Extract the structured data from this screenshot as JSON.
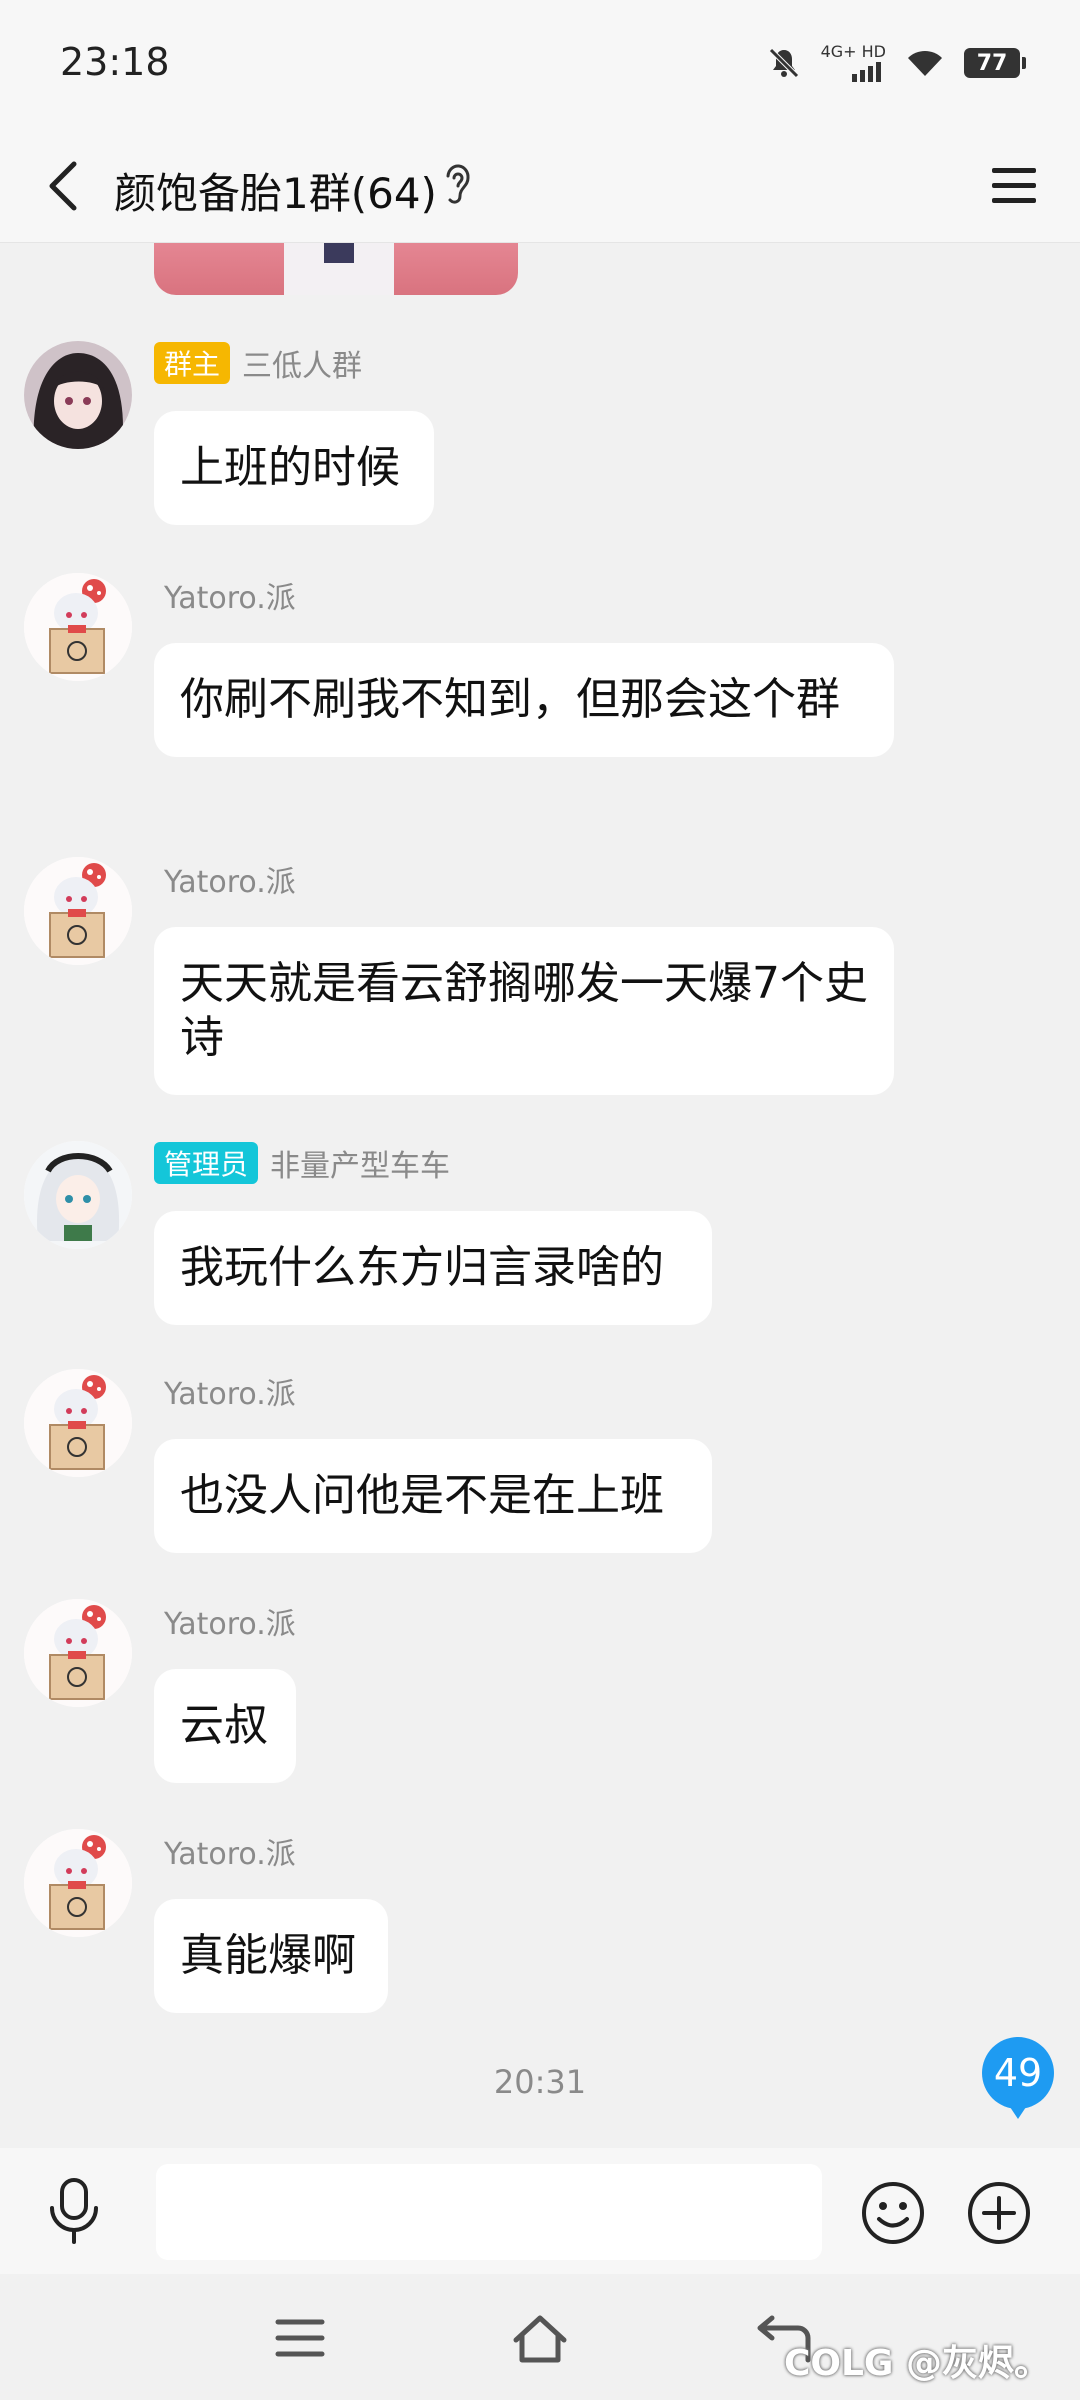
{
  "status_bar": {
    "time": "23:18",
    "network": "4G+ HD",
    "battery": "77"
  },
  "header": {
    "title": "颜饱备胎1群(64)"
  },
  "messages": [
    {
      "role_badge": "群主",
      "sender": "三低人群",
      "text": "上班的时候"
    },
    {
      "sender": "Yatoro.派",
      "text": "你刷不刷我不知到，但那会这个群"
    },
    {
      "sender": "Yatoro.派",
      "text": "天天就是看云舒搁哪发一天爆7个史诗"
    },
    {
      "role_badge": "管理员",
      "sender": "非量产型车车",
      "text": "我玩什么东方归言录啥的"
    },
    {
      "sender": "Yatoro.派",
      "text": "也没人问他是不是在上班"
    },
    {
      "sender": "Yatoro.派",
      "text": "云叔"
    },
    {
      "sender": "Yatoro.派",
      "text": "真能爆啊"
    }
  ],
  "time_separator": "20:31",
  "unread_count": "49",
  "input": {
    "value": "",
    "placeholder": ""
  },
  "watermark": "COLG @灰烬。",
  "colors": {
    "owner_badge": "#f6b701",
    "admin_badge": "#14c6d9",
    "unread_bubble": "#1e9bf2"
  }
}
